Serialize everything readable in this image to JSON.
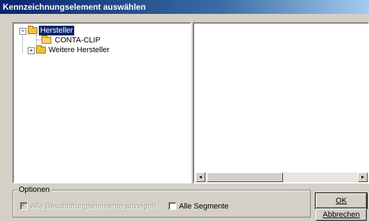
{
  "window": {
    "title": "Kennzeichnungselement auswählen"
  },
  "tree": {
    "items": [
      {
        "label": "Hersteller",
        "selected": true,
        "expander": "−"
      },
      {
        "label": "CONTA-CLIP",
        "selected": false
      },
      {
        "label": "Weitere Hersteller",
        "selected": false,
        "expander": "+"
      }
    ]
  },
  "options": {
    "title": "Optionen",
    "show_all_label": "Alle Beschriftungselemente anzeigen",
    "show_all_checked": true,
    "show_all_enabled": false,
    "all_segments_label": "Alle Segmente",
    "all_segments_checked": false
  },
  "buttons": {
    "ok_label": "OK",
    "cancel_label": "Abbrechen"
  },
  "icons": {
    "expander_open": "minus-box-icon",
    "expander_closed": "plus-box-icon",
    "folder": "folder-icon",
    "scroll_left": "◂",
    "scroll_right": "▸"
  }
}
